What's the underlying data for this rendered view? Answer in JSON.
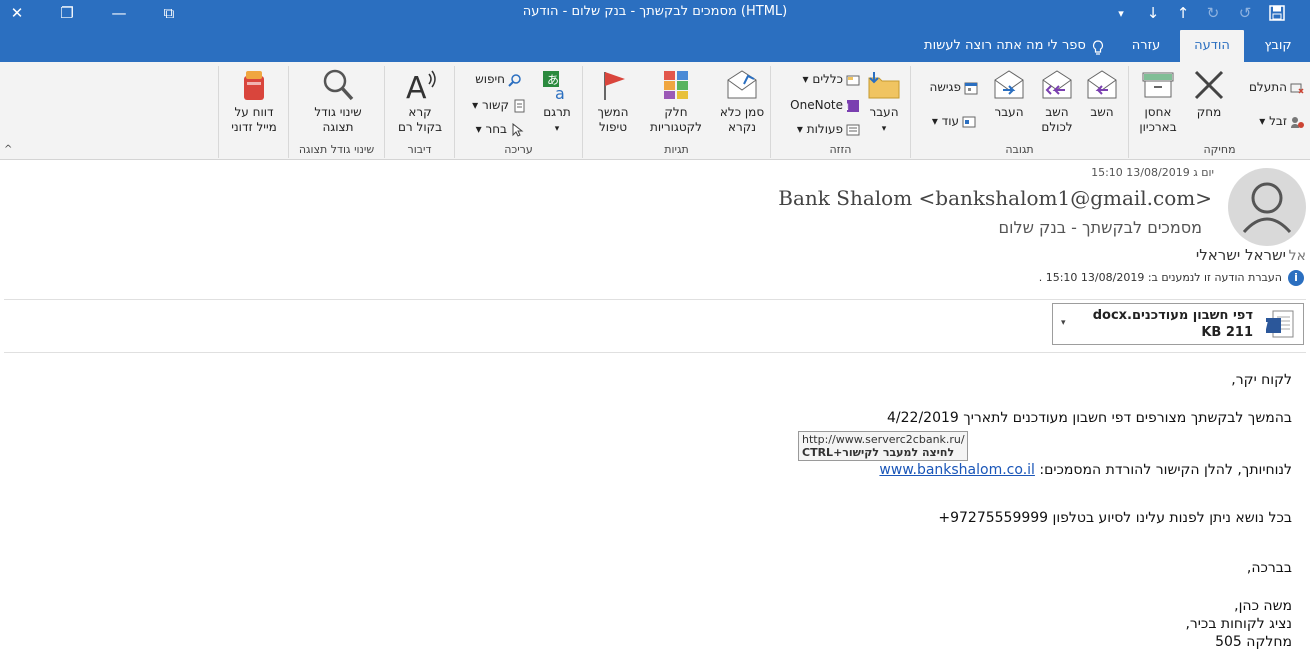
{
  "window": {
    "title": "מסמכים לבקשתך - בנק שלום  -  הודעה (HTML)",
    "controls": {
      "close": "✕",
      "restore": "❐",
      "minimize": "—",
      "ribbon_display": "⧉"
    },
    "qat": {
      "customize": "▾",
      "down": "↓",
      "up": "↑",
      "redo": "↻",
      "undo": "↺",
      "save": "save"
    }
  },
  "tabs": [
    {
      "label": "קובץ"
    },
    {
      "label": "הודעה",
      "active": true
    },
    {
      "label": "עזרה"
    }
  ],
  "tell_me": "ספר לי מה אתה רוצה לעשות",
  "ribbon": {
    "delete_group": {
      "label": "מחיקה",
      "ignore": "התעלם",
      "junk": "זבל",
      "delete": "מחק",
      "archive": "אחסן בארכיון"
    },
    "respond_group": {
      "label": "תגובה",
      "reply": "השב",
      "reply_all": "השב לכולם",
      "forward": "העבר",
      "meeting": "פגישה",
      "more": "עוד"
    },
    "move_group": {
      "label": "הזזה",
      "move": "העבר",
      "rules": "כללים",
      "onenote": "OneNote",
      "actions": "פעולות"
    },
    "tags_group": {
      "label": "תגיות",
      "mark_unread": "סמן כלא נקרא",
      "categorize": "חלק לקטגוריות",
      "follow_up": "המשך טיפול"
    },
    "editing_group": {
      "label": "עריכה",
      "translate": "תרגם",
      "find": "חיפוש",
      "related": "קשור",
      "select": "בחר"
    },
    "speech_group": {
      "label": "דיבור",
      "read_aloud": "קרא בקול רם"
    },
    "zoom_group": {
      "label": "שינוי גודל תצוגה",
      "zoom": "שינוי גודל תצוגה"
    },
    "phish": {
      "report": "דווח על מייל זדוני"
    }
  },
  "message": {
    "date": "יום ג 13/08/2019 15:10",
    "sender": "Bank Shalom <bankshalom1@gmail.com>",
    "subject": "מסמכים לבקשתך - בנק שלום",
    "to_label": "אל",
    "to_name": "ישראל ישראלי",
    "info_icon": "i",
    "forward_info": "העברת הודעה זו לנמענים ב: 13/08/2019 15:10 ."
  },
  "attachment": {
    "name": "דפי חשבון מעודכנים.docx",
    "size": "211 KB",
    "dropdown": "▾"
  },
  "body": {
    "greeting": "לקוח יקר,",
    "line1": "בהמשך לבקשתך מצורפים דפי חשבון מעודכנים לתאריך 4/22/2019",
    "line2_prefix": "לנוחיותך, להלן הקישור להורדת המסמכים:",
    "link_text": "www.bankshalom.co.il",
    "line3": "בכל נושא ניתן לפנות עלינו לסיוע בטלפון 97275559999+",
    "closing": "בברכה,",
    "sig_name": "משה כהן,",
    "sig_title": "נציג לקוחות בכיר,",
    "sig_dept": "מחלקה 505"
  },
  "tooltip": {
    "url": "http://www.serverc2cbank.ru/",
    "hint": "לחיצה למעבר לקישור+CTRL"
  },
  "colors": {
    "accent": "#2b6fc0",
    "ribbon_bg": "#f3f3f3",
    "link": "#1a56b8"
  }
}
